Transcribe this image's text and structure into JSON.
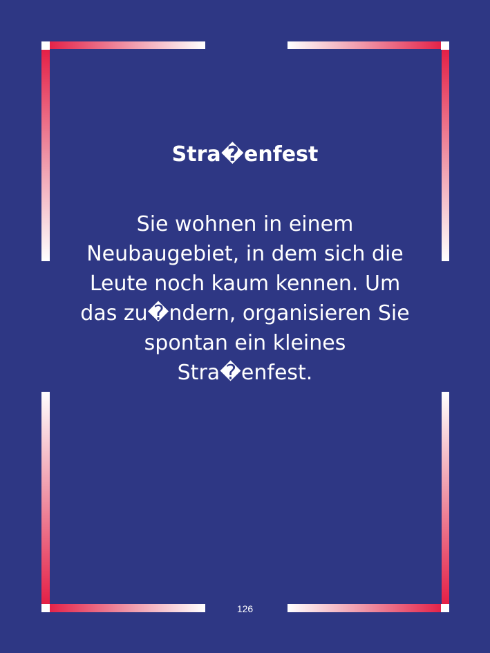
{
  "card": {
    "title": "Stra�enfest",
    "body_lines": [
      "Sie wohnen in einem",
      "Neubaugebiet, in dem sich die",
      "Leute noch kaum kennen. Um",
      "das zu�ndern, organisieren Sie",
      "spontan ein kleines",
      "Stra�enfest."
    ],
    "page_number": "126"
  },
  "colors": {
    "background": "#2e3784",
    "accent_red": "#e3173f",
    "frame_white": "#ffffff",
    "text": "#ffffff"
  }
}
